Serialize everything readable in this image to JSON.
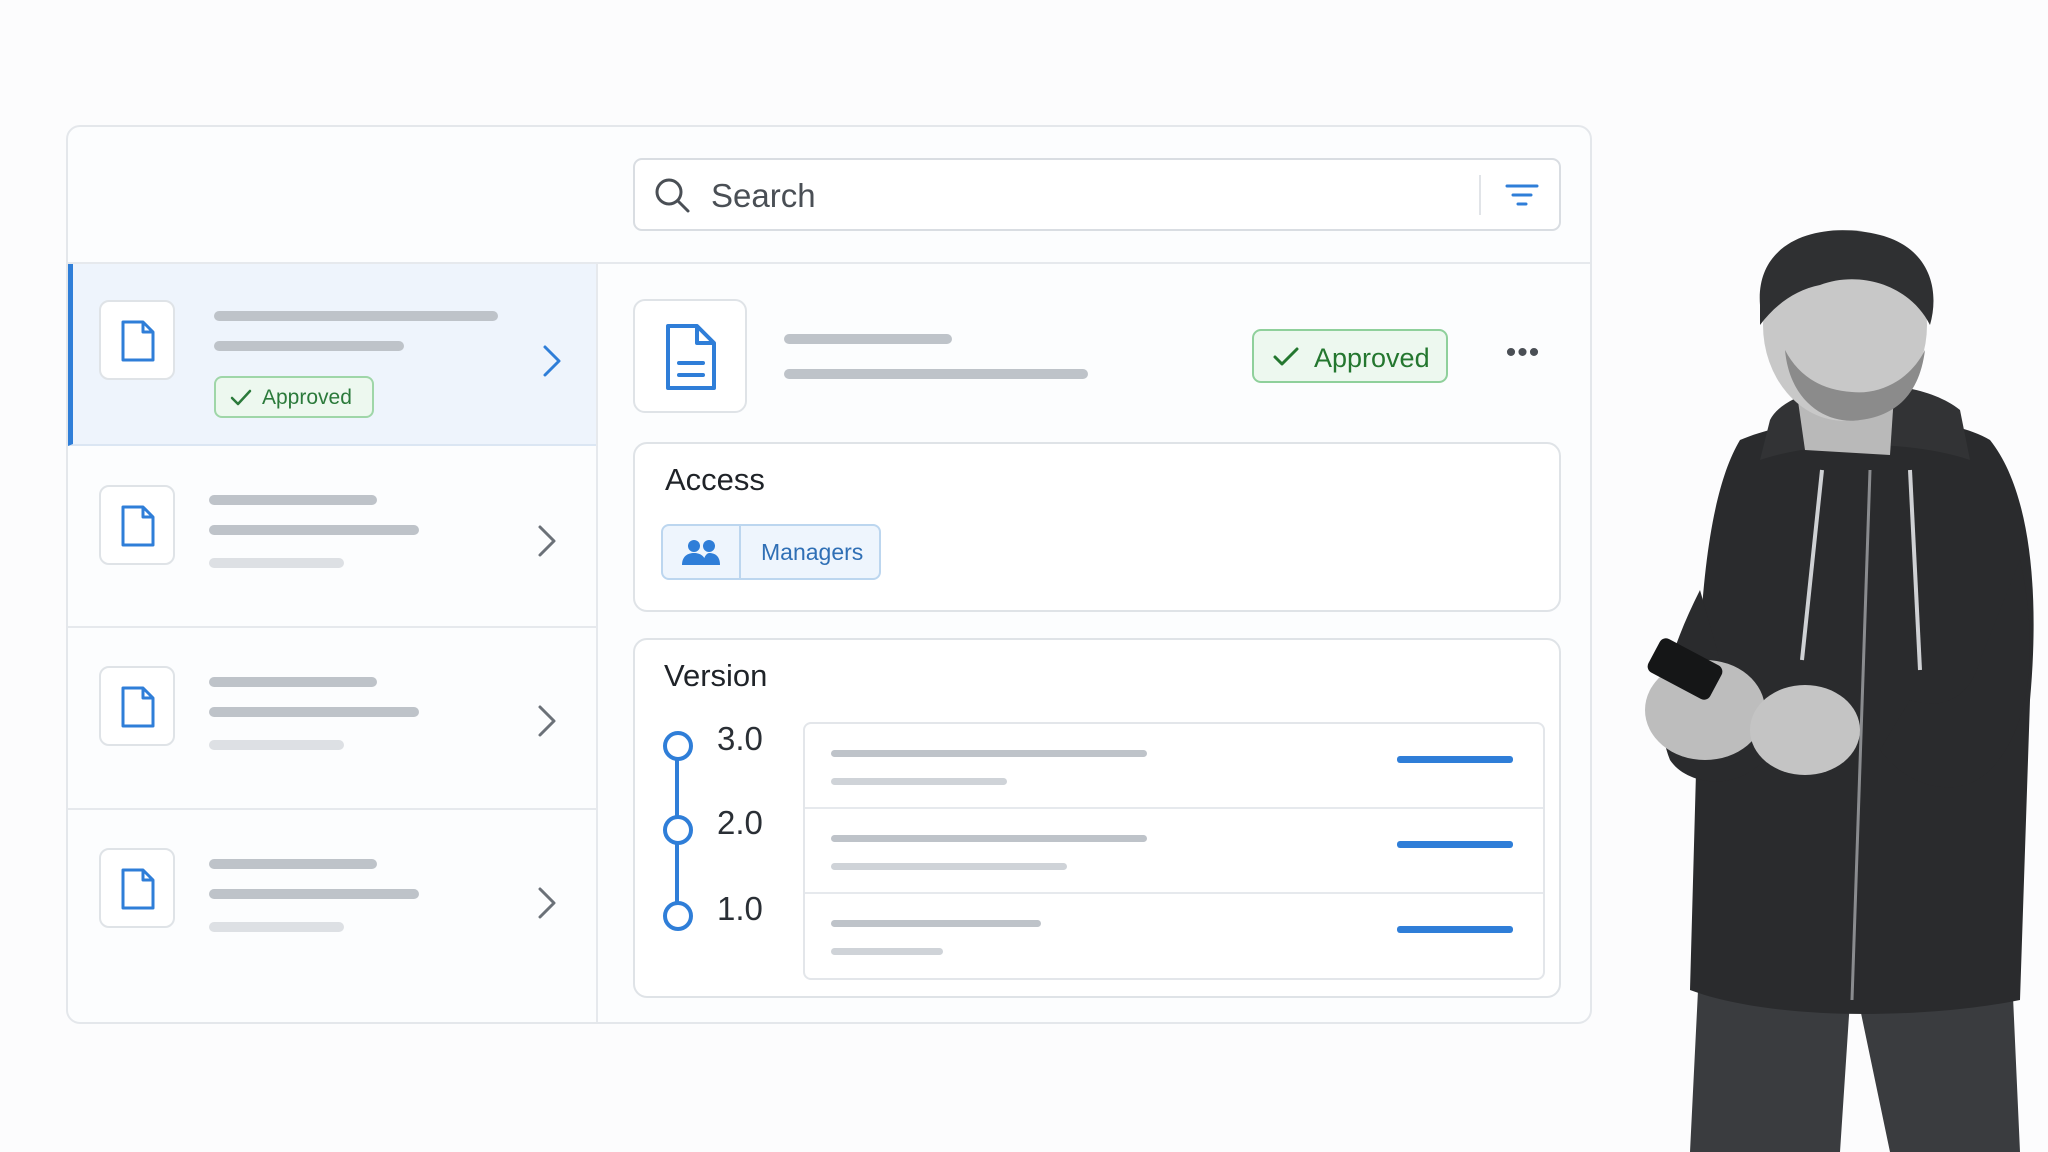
{
  "search": {
    "placeholder": "Search"
  },
  "sidebar": {
    "items": [
      {
        "status": "Approved",
        "selected": true
      },
      {
        "selected": false
      },
      {
        "selected": false
      },
      {
        "selected": false
      }
    ]
  },
  "detail": {
    "status": "Approved",
    "more_label": "•••",
    "access": {
      "title": "Access",
      "group": "Managers"
    },
    "version": {
      "title": "Version",
      "items": [
        {
          "label": "3.0"
        },
        {
          "label": "2.0"
        },
        {
          "label": "1.0"
        }
      ]
    }
  },
  "colors": {
    "accent": "#2f7ed8",
    "approved_green": "#24772f",
    "approved_bg": "#edf8ef",
    "placeholder_bar": "#bec3c9"
  },
  "icons": [
    "search-icon",
    "filter-icon",
    "document-icon",
    "chevron-right-icon",
    "check-icon",
    "more-icon",
    "group-icon"
  ]
}
